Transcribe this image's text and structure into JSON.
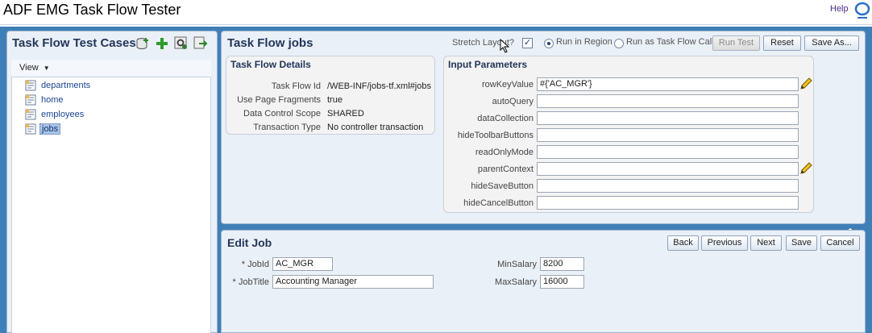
{
  "app": {
    "title": "ADF EMG Task Flow Tester",
    "help_label": "Help"
  },
  "left": {
    "title": "Task Flow Test Cases",
    "toolbar_icons": [
      "database-icon",
      "add-icon",
      "settings-icon",
      "export-icon"
    ],
    "view_label": "View",
    "tree_items": [
      {
        "label": "departments",
        "selected": false
      },
      {
        "label": "home",
        "selected": false
      },
      {
        "label": "employees",
        "selected": false
      },
      {
        "label": "jobs",
        "selected": true
      }
    ]
  },
  "taskflow": {
    "title": "Task Flow jobs",
    "stretch_label": "Stretch Layout?",
    "stretch_checked": true,
    "run_region_label": "Run in Region",
    "run_call_label": "Run as Task Flow Call",
    "run_mode": "region",
    "buttons": {
      "run_test": "Run Test",
      "reset": "Reset",
      "save_as": "Save As..."
    },
    "details": {
      "title": "Task Flow Details",
      "rows": [
        {
          "label": "Task Flow Id",
          "value": "/WEB-INF/jobs-tf.xml#jobs"
        },
        {
          "label": "Use Page Fragments",
          "value": "true"
        },
        {
          "label": "Data Control Scope",
          "value": "SHARED"
        },
        {
          "label": "Transaction Type",
          "value": "No controller transaction"
        }
      ]
    },
    "params": {
      "title": "Input Parameters",
      "rows": [
        {
          "label": "rowKeyValue",
          "value": "#{'AC_MGR'}",
          "editable_icon": true
        },
        {
          "label": "autoQuery",
          "value": "",
          "editable_icon": false
        },
        {
          "label": "dataCollection",
          "value": "",
          "editable_icon": false
        },
        {
          "label": "hideToolbarButtons",
          "value": "",
          "editable_icon": false
        },
        {
          "label": "readOnlyMode",
          "value": "",
          "editable_icon": false
        },
        {
          "label": "parentContext",
          "value": "",
          "editable_icon": true
        },
        {
          "label": "hideSaveButton",
          "value": "",
          "editable_icon": false
        },
        {
          "label": "hideCancelButton",
          "value": "",
          "editable_icon": false
        }
      ]
    }
  },
  "edit_job": {
    "title": "Edit Job",
    "buttons": {
      "back": "Back",
      "previous": "Previous",
      "next": "Next",
      "save": "Save",
      "cancel": "Cancel"
    },
    "fields": {
      "job_id_label": "* JobId",
      "job_id_value": "AC_MGR",
      "job_title_label": "* JobTitle",
      "job_title_value": "Accounting Manager",
      "min_salary_label": "MinSalary",
      "min_salary_value": "8200",
      "max_salary_label": "MaxSalary",
      "max_salary_value": "16000"
    }
  }
}
